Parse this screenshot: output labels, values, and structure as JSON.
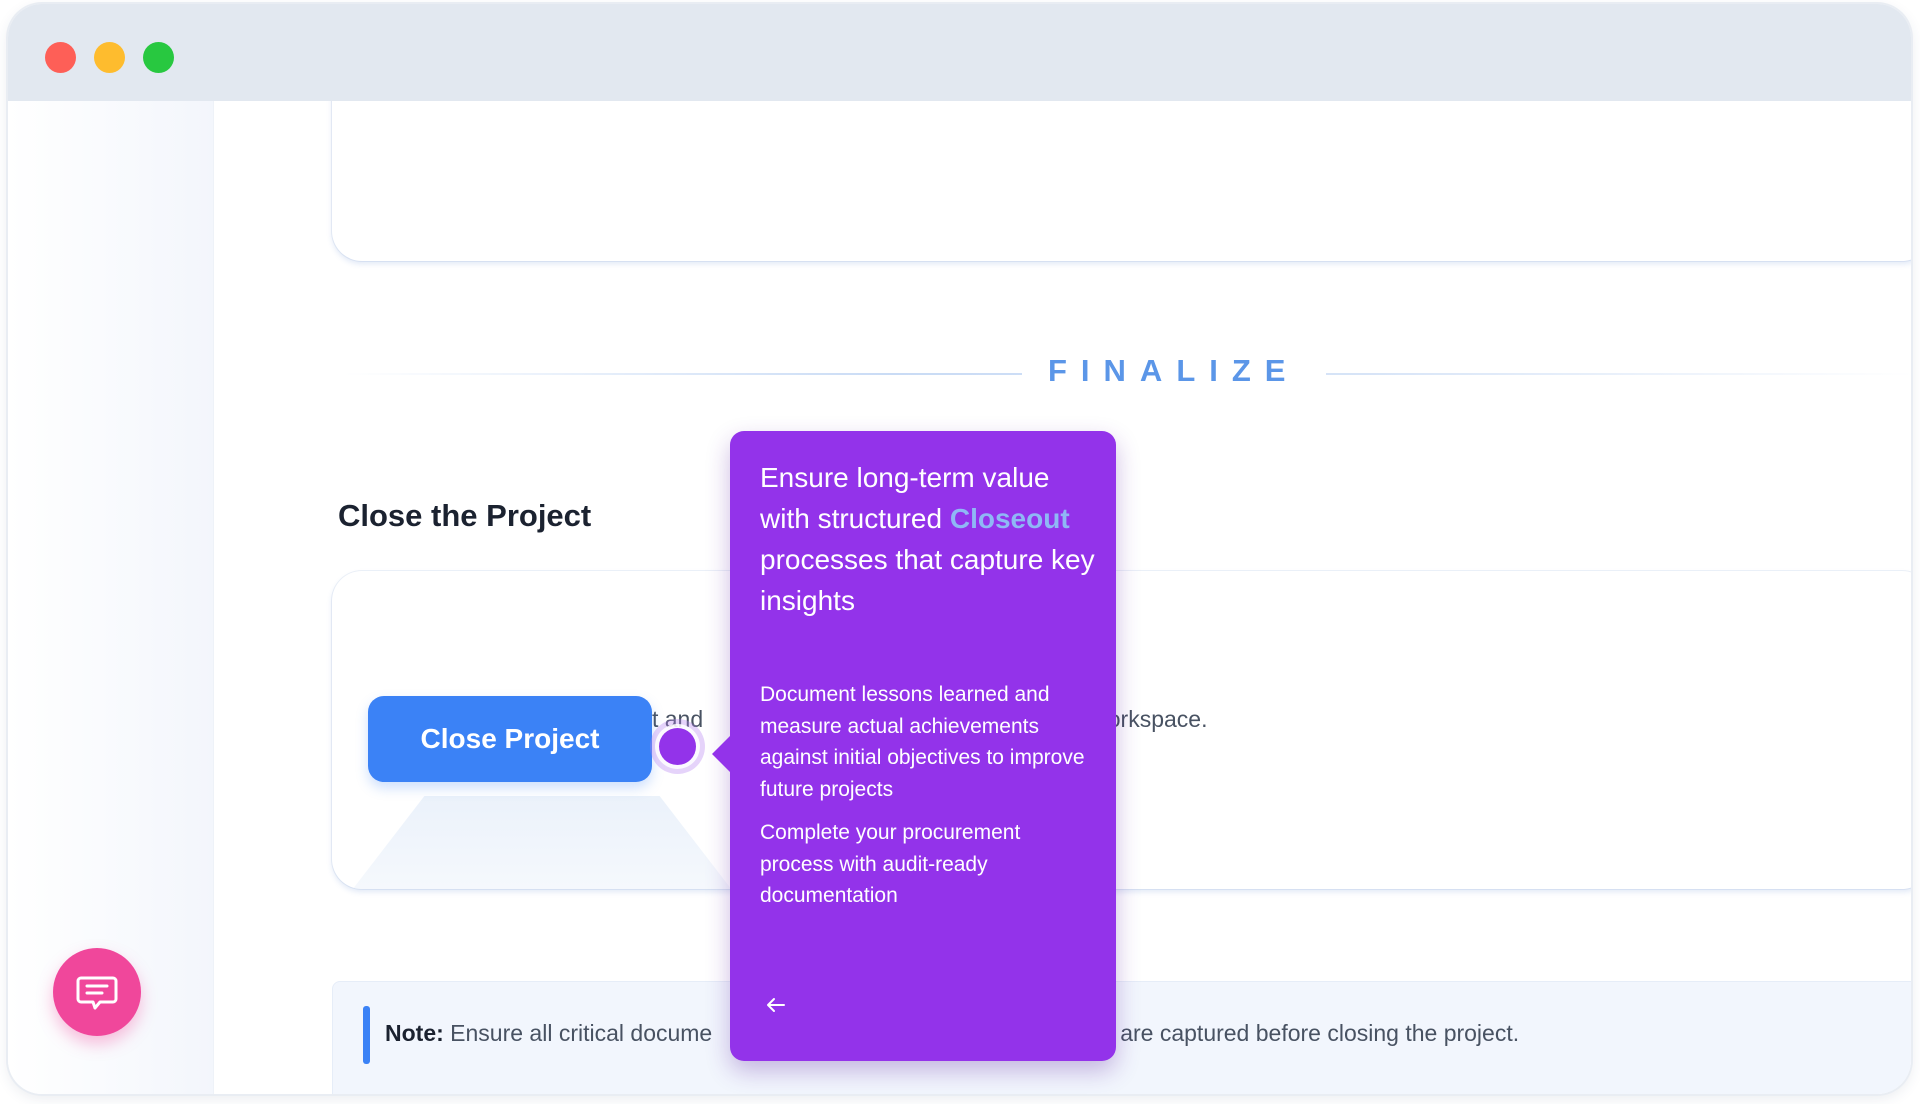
{
  "section": {
    "label": "FINALIZE",
    "title": "Close the Project"
  },
  "close_card": {
    "description_left": "Finalize the sourcing project and",
    "description_right": "workspace.",
    "button_label": "Close Project"
  },
  "note": {
    "label": "Note:",
    "text_left": "Ensure all critical docume",
    "text_right": "ed are captured before closing the project."
  },
  "tooltip": {
    "heading_part1": "Ensure long-term value with structured ",
    "heading_highlight": "Closeout",
    "heading_part2": " processes that capture key insights",
    "paragraph1": "Document lessons learned and measure actual achievements against initial objectives to improve future projects",
    "paragraph2": "Complete your procurement process with audit-ready documentation"
  },
  "icons": {
    "chat": "chat-icon",
    "back": "arrow-left-icon"
  },
  "colors": {
    "primary_button": "#3b82f6",
    "tooltip_bg": "#9333ea",
    "highlight": "#8fb8f5",
    "chat_button": "#f0479b",
    "section_label": "#5b96e8"
  }
}
